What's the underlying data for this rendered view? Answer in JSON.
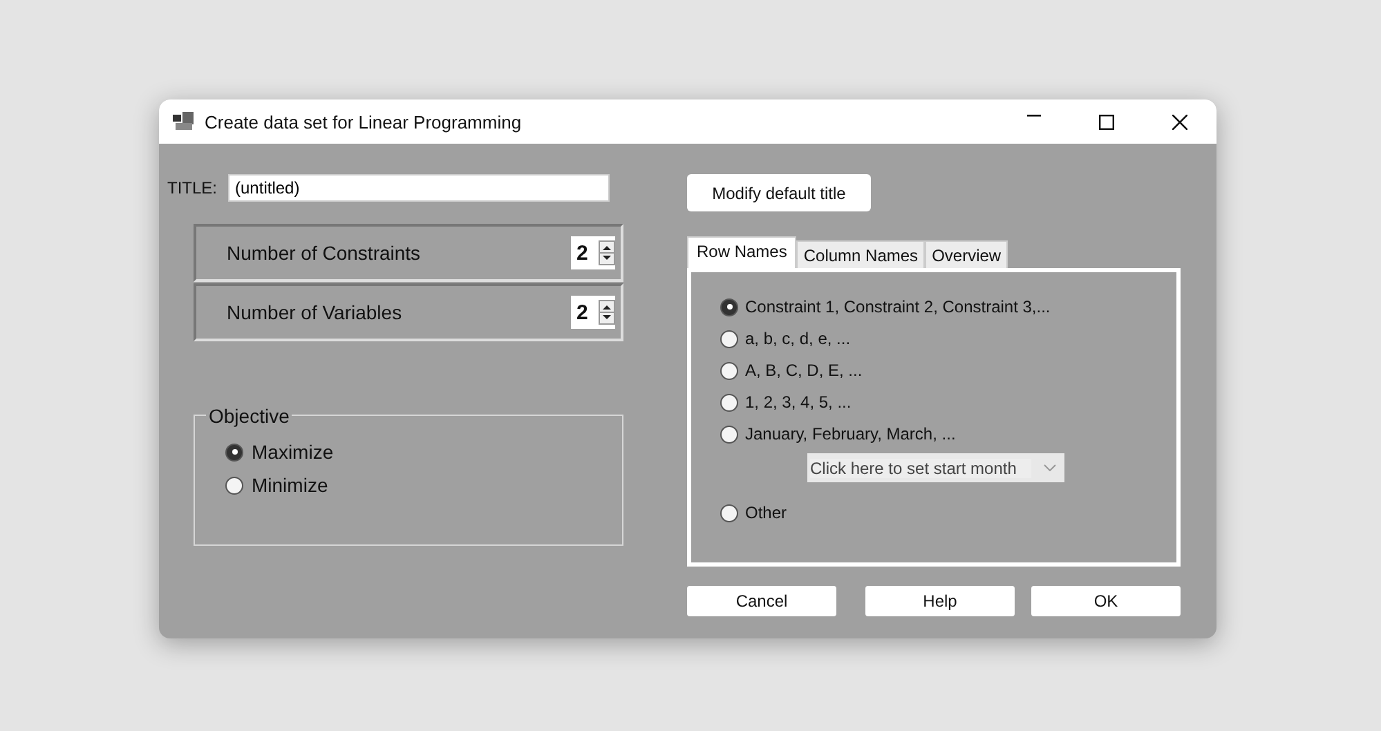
{
  "window": {
    "title": "Create data set for Linear Programming"
  },
  "title_field": {
    "label": "TITLE:",
    "value": "(untitled)"
  },
  "counts": [
    {
      "label": "Number of Constraints",
      "value": "2"
    },
    {
      "label": "Number of Variables",
      "value": "2"
    }
  ],
  "objective": {
    "label": "Objective",
    "options": [
      {
        "label": "Maximize",
        "selected": true
      },
      {
        "label": "Minimize",
        "selected": false
      }
    ]
  },
  "modify_button": "Modify default title",
  "tabs": [
    {
      "label": "Row Names",
      "selected": true
    },
    {
      "label": "Column Names",
      "selected": false
    },
    {
      "label": "Overview",
      "selected": false
    }
  ],
  "row_names": [
    {
      "label": "Constraint 1, Constraint 2, Constraint 3,...",
      "selected": true
    },
    {
      "label": "a, b, c, d, e, ...",
      "selected": false
    },
    {
      "label": "A, B, C, D, E, ...",
      "selected": false
    },
    {
      "label": "1, 2, 3, 4, 5, ...",
      "selected": false
    },
    {
      "label": "January, February, March, ...",
      "selected": false
    },
    {
      "label": "Other",
      "selected": false
    }
  ],
  "start_month": {
    "placeholder": "Click here to set start month"
  },
  "buttons": [
    "Cancel",
    "Help",
    "OK"
  ]
}
